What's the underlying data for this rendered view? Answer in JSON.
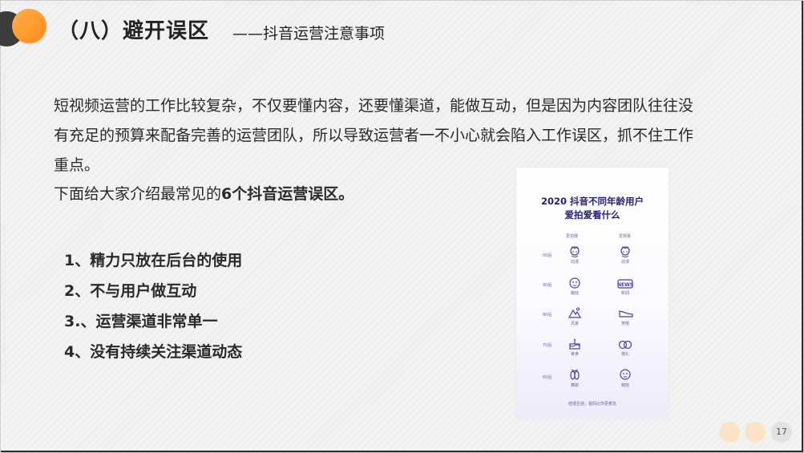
{
  "slide": {
    "title": "（八）避开误区",
    "subtitle": "——抖音运营注意事项",
    "paragraph_lines": [
      "短视频运营的工作比较复杂，不仅要懂内容，还要懂渠道，能做互动，但是因为内容团队往往没",
      "有充足的预算来配备完善的运营团队，所以导致运营者一不小心就会陷入工作误区，抓不住工作",
      "重点。"
    ],
    "intro_prefix": "下面给大家介绍最常见的",
    "intro_bold": "6个抖音运营误区。",
    "list": [
      "1、精力只放在后台的使用",
      "2、不与用户做互动",
      "3.、运营渠道非常单一",
      "4、没有持续关注渠道动态"
    ],
    "page_number": "17"
  },
  "card": {
    "title_line1": "2020 抖音不同年龄用户",
    "title_line2": "爱拍爱看什么",
    "col_left": "爱拍摄",
    "col_right": "爱观看",
    "footer": "结婚生娃，爸妈比你更着急",
    "rows": [
      {
        "age": "00后",
        "left_label": "动漫",
        "right_label": "动漫",
        "left_icon": "anime-character-icon",
        "right_icon": "anime-character-icon"
      },
      {
        "age": "90后",
        "left_label": "萌娃",
        "right_label": "新闻",
        "left_icon": "baby-face-icon",
        "right_icon": "news-icon"
      },
      {
        "age": "80后",
        "left_label": "风景",
        "right_label": "穿搭",
        "left_icon": "mountain-icon",
        "right_icon": "shoe-icon"
      },
      {
        "age": "70后",
        "left_label": "美食",
        "right_label": "婚礼",
        "left_icon": "cake-icon",
        "right_icon": "rings-icon"
      },
      {
        "age": "60后",
        "left_label": "舞蹈",
        "right_label": "萌娃",
        "left_icon": "ballet-shoes-icon",
        "right_icon": "baby-face-icon"
      }
    ],
    "accent_color": "#27207a",
    "icon_color": "#4a3fa0"
  },
  "theme": {
    "orange": "#ff8a1a",
    "dark": "#3c3c3c"
  }
}
